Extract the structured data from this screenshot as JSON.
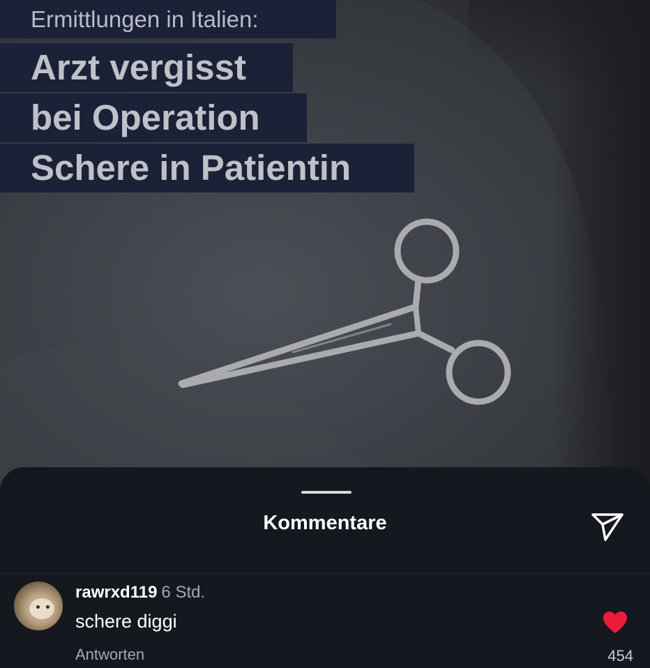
{
  "media": {
    "kicker": "Ermittlungen in Italien:",
    "title_lines": [
      "Arzt vergisst",
      "bei Operation",
      "Schere in Patientin"
    ]
  },
  "comments_sheet": {
    "title": "Kommentare",
    "share_icon": "send-icon",
    "comments": [
      {
        "username": "rawrxd119",
        "time": "6 Std.",
        "text": "schere diggi",
        "reply_label": "Antworten",
        "likes": "454",
        "liked": true,
        "like_color": "#ed1c3c"
      }
    ]
  }
}
